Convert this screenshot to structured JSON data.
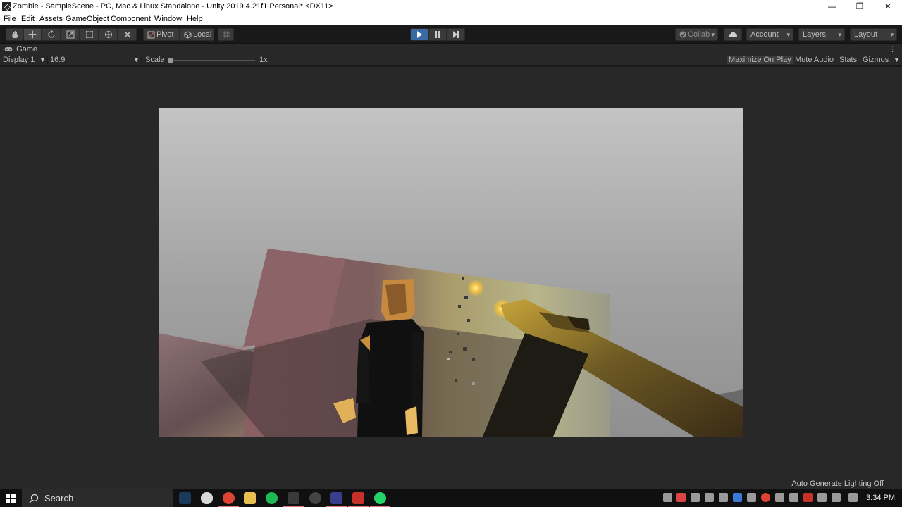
{
  "window": {
    "title": "Zombie - SampleScene - PC, Mac & Linux Standalone - Unity 2019.4.21f1 Personal* <DX11>",
    "controls": {
      "minimize": "—",
      "restore": "❐",
      "close": "✕"
    }
  },
  "menu": [
    "File",
    "Edit",
    "Assets",
    "GameObject",
    "Component",
    "Window",
    "Help"
  ],
  "toolbar": {
    "tools": [
      "hand-icon",
      "move-icon",
      "rotate-icon",
      "scale-icon",
      "rect-tool-icon",
      "transform-icon",
      "custom-tool-icon"
    ],
    "active_tool": "move-icon",
    "pivot_label": "Pivot",
    "local_label": "Local",
    "collab_label": "Collab",
    "account_label": "Account",
    "layers_label": "Layers",
    "layout_label": "Layout",
    "play_active": true
  },
  "game_panel": {
    "tab_label": "Game",
    "display_label": "Display 1",
    "aspect_label": "16:9",
    "scale_label": "Scale",
    "scale_value": "1x",
    "scale_level": 0,
    "maximize_label": "Maximize On Play",
    "mute_label": "Mute Audio",
    "stats_label": "Stats",
    "gizmos_label": "Gizmos"
  },
  "status": {
    "lighting": "Auto Generate Lighting Off"
  },
  "taskbar": {
    "search_placeholder": "Search",
    "time": "3:34 PM"
  },
  "colors": {
    "accent_play": "#3a6aa4",
    "editor_bg": "#191919",
    "panel_bg": "#282828"
  }
}
